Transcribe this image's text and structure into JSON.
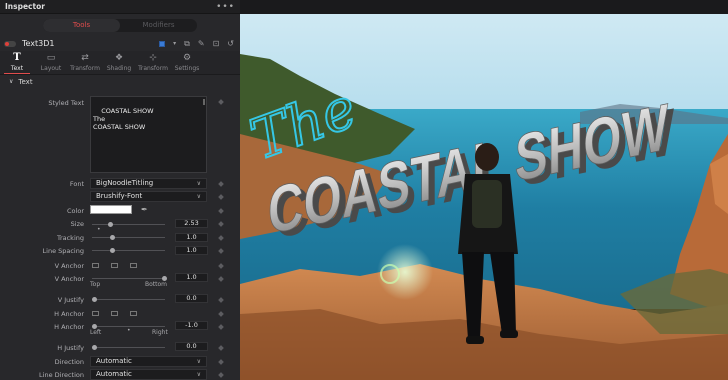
{
  "inspector": {
    "title": "Inspector",
    "menu_icon": "ellipsis-icon",
    "mode_tabs": [
      "Tools",
      "Modifiers"
    ],
    "active_mode": "Tools",
    "node_name": "Text3D1",
    "tabs": [
      {
        "label": "Text",
        "icon": "text-icon"
      },
      {
        "label": "Layout",
        "icon": "layout-icon"
      },
      {
        "label": "Transform",
        "icon": "transform-icon"
      },
      {
        "label": "Shading",
        "icon": "shading-icon"
      },
      {
        "label": "Transform",
        "icon": "transform-3d-icon"
      },
      {
        "label": "Settings",
        "icon": "settings-icon"
      }
    ],
    "active_tab": "Text",
    "section_title": "Text"
  },
  "fields": {
    "styled_text_label": "Styled Text",
    "styled_text_value": "COASTAL SHOW\nThe\nCOASTAL SHOW",
    "font_label": "Font",
    "font_family": "BigNoodleTitling",
    "font_style": "Brushify-Font",
    "color_label": "Color",
    "color_value": "#ffffff",
    "size_label": "Size",
    "size_value": "2.53",
    "tracking_label": "Tracking",
    "tracking_value": "1.0",
    "line_spacing_label": "Line Spacing",
    "line_spacing_value": "1.0",
    "v_anchor_label": "V Anchor",
    "v_anchor2_label": "V Anchor",
    "v_anchor_value": "1.0",
    "v_anchor_top": "Top",
    "v_anchor_bottom": "Bottom",
    "v_justify_label": "V Justify",
    "v_justify_value": "0.0",
    "h_anchor_label": "H Anchor",
    "h_anchor2_label": "H Anchor",
    "h_anchor_value": "-1.0",
    "h_anchor_left": "Left",
    "h_anchor_right": "Right",
    "h_justify_label": "H Justify",
    "h_justify_value": "0.0",
    "direction_label": "Direction",
    "direction_value": "Automatic",
    "line_direction_label": "Line Direction",
    "line_direction_value": "Automatic"
  },
  "viewer": {
    "title_script": "The",
    "title_main": "COASTAL SHOW"
  },
  "colors": {
    "accent": "#e04c4c",
    "panel": "#28282b",
    "sea": "#1f8fb0",
    "sky": "#bfe4f2",
    "rock": "#c97a45",
    "script_text": "#35c7e6"
  }
}
